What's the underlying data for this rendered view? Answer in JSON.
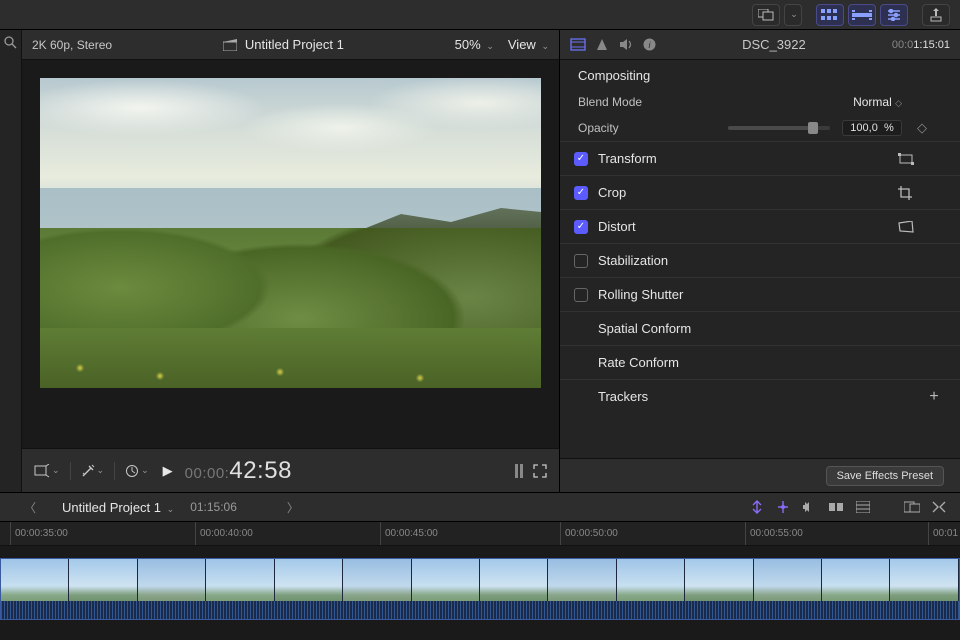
{
  "viewer": {
    "format": "2K 60p, Stereo",
    "project_title": "Untitled Project 1",
    "zoom": "50%",
    "view_menu": "View",
    "timecode_prefix": "00:00:",
    "timecode_big": "42:58"
  },
  "inspector": {
    "clip_name": "DSC_3922",
    "clip_tc_dim": "00:0",
    "clip_tc": "1:15:01",
    "compositing": "Compositing",
    "blend_mode_label": "Blend Mode",
    "blend_mode_value": "Normal",
    "opacity_label": "Opacity",
    "opacity_value": "100,0",
    "opacity_unit": "%",
    "transform": "Transform",
    "crop": "Crop",
    "distort": "Distort",
    "stabilization": "Stabilization",
    "rolling_shutter": "Rolling Shutter",
    "spatial_conform": "Spatial Conform",
    "rate_conform": "Rate Conform",
    "trackers": "Trackers",
    "save_preset": "Save Effects Preset"
  },
  "timeline": {
    "project_title": "Untitled Project 1",
    "duration": "01:15:06",
    "ruler": [
      "00:00:35:00",
      "00:00:40:00",
      "00:00:45:00",
      "00:00:50:00",
      "00:00:55:00",
      "00:01"
    ]
  }
}
